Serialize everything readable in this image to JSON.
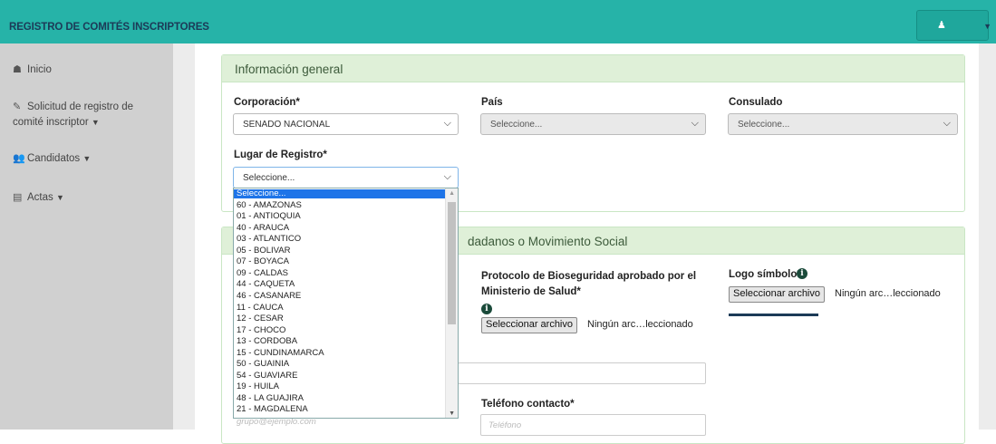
{
  "header": {
    "title": "REGISTRO DE COMITÉS INSCRIPTORES",
    "user_icon": "user-icon"
  },
  "sidebar": {
    "items": [
      {
        "icon": "dashboard-icon",
        "glyph": "☗",
        "label": "Inicio"
      },
      {
        "icon": "edit-icon",
        "glyph": "✎",
        "label_line1": "Solicitud de registro de",
        "label_line2": "comité inscriptor"
      },
      {
        "icon": "users-icon",
        "glyph": "👥",
        "label": "Candidatos"
      },
      {
        "icon": "file-pdf-icon",
        "glyph": "▤",
        "label": "Actas"
      }
    ]
  },
  "panel_general": {
    "heading": "Información general",
    "corporacion": {
      "label": "Corporación*",
      "value": "SENADO NACIONAL"
    },
    "pais": {
      "label": "País",
      "value": "Seleccione..."
    },
    "consulado": {
      "label": "Consulado",
      "value": "Seleccione..."
    },
    "lugar": {
      "label": "Lugar de Registro*",
      "value": "Seleccione..."
    }
  },
  "panel_grupo": {
    "heading_visible": "dadanos o Movimiento Social",
    "protocolo": {
      "label_line1": "Protocolo de Bioseguridad aprobado por el",
      "label_line2": "Ministerio de Salud*",
      "button": "Seleccionar archivo",
      "file_text": "Ningún arc…leccionado"
    },
    "logo": {
      "label": "Logo símbolo*",
      "button": "Seleccionar archivo",
      "file_text": "Ningún arc…leccionado"
    },
    "telefono": {
      "label": "Teléfono contacto*",
      "placeholder": "Teléfono"
    },
    "email": {
      "placeholder": "grupo@ejemplo.com"
    }
  },
  "dropdown": {
    "options": [
      "Seleccione...",
      "60 - AMAZONAS",
      "01 - ANTIOQUIA",
      "40 - ARAUCA",
      "03 - ATLANTICO",
      "05 - BOLIVAR",
      "07 - BOYACA",
      "09 - CALDAS",
      "44 - CAQUETA",
      "46 - CASANARE",
      "11 - CAUCA",
      "12 - CESAR",
      "17 - CHOCO",
      "13 - CORDOBA",
      "15 - CUNDINAMARCA",
      "50 - GUAINIA",
      "54 - GUAVIARE",
      "19 - HUILA",
      "48 - LA GUAJIRA",
      "21 - MAGDALENA"
    ],
    "selected_index": 0
  },
  "colors": {
    "header": "#26b3a8",
    "panel_head": "#dff0d8",
    "selected": "#1e74e8"
  }
}
